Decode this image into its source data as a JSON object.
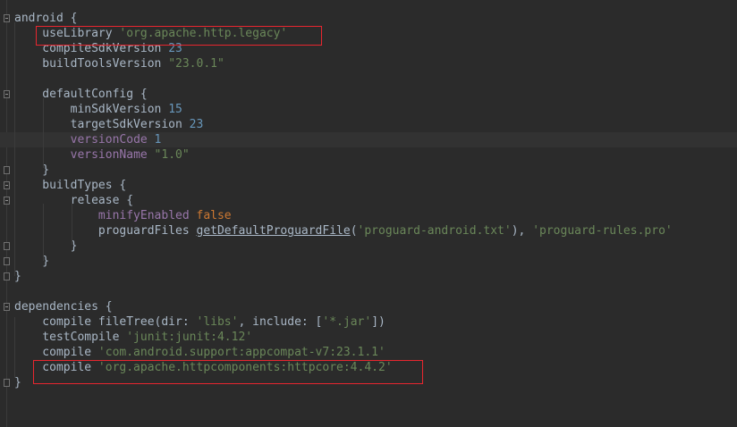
{
  "editor": {
    "lines": [
      {
        "tokens": [
          {
            "t": "android {",
            "c": "kw"
          }
        ]
      },
      {
        "tokens": [
          {
            "t": "    useLibrary ",
            "c": "kw"
          },
          {
            "t": "'org.apache.http.legacy'",
            "c": "str"
          }
        ]
      },
      {
        "tokens": [
          {
            "t": "    compileSdkVersion ",
            "c": "kw"
          },
          {
            "t": "23",
            "c": "num"
          }
        ]
      },
      {
        "tokens": [
          {
            "t": "    buildToolsVersion ",
            "c": "kw"
          },
          {
            "t": "\"23.0.1\"",
            "c": "str"
          }
        ]
      },
      {
        "tokens": [
          {
            "t": "",
            "c": "kw"
          }
        ]
      },
      {
        "tokens": [
          {
            "t": "    defaultConfig {",
            "c": "kw"
          }
        ]
      },
      {
        "tokens": [
          {
            "t": "        minSdkVersion ",
            "c": "kw"
          },
          {
            "t": "15",
            "c": "num"
          }
        ]
      },
      {
        "tokens": [
          {
            "t": "        targetSdkVersion ",
            "c": "kw"
          },
          {
            "t": "23",
            "c": "num"
          }
        ]
      },
      {
        "tokens": [
          {
            "t": "        ",
            "c": "kw"
          },
          {
            "t": "versionCode ",
            "c": "prop"
          },
          {
            "t": "1",
            "c": "num"
          }
        ]
      },
      {
        "tokens": [
          {
            "t": "        ",
            "c": "kw"
          },
          {
            "t": "versionName ",
            "c": "prop"
          },
          {
            "t": "\"1.0\"",
            "c": "str"
          }
        ]
      },
      {
        "tokens": [
          {
            "t": "    }",
            "c": "kw"
          }
        ]
      },
      {
        "tokens": [
          {
            "t": "    buildTypes {",
            "c": "kw"
          }
        ]
      },
      {
        "tokens": [
          {
            "t": "        release {",
            "c": "kw"
          }
        ]
      },
      {
        "tokens": [
          {
            "t": "            ",
            "c": "kw"
          },
          {
            "t": "minifyEnabled ",
            "c": "prop"
          },
          {
            "t": "false",
            "c": "bool"
          }
        ]
      },
      {
        "tokens": [
          {
            "t": "            proguardFiles ",
            "c": "kw"
          },
          {
            "t": "getDefaultProguardFile",
            "c": "method"
          },
          {
            "t": "(",
            "c": "kw"
          },
          {
            "t": "'proguard-android.txt'",
            "c": "str"
          },
          {
            "t": "), ",
            "c": "kw"
          },
          {
            "t": "'proguard-rules.pro'",
            "c": "str"
          }
        ]
      },
      {
        "tokens": [
          {
            "t": "        }",
            "c": "kw"
          }
        ]
      },
      {
        "tokens": [
          {
            "t": "    }",
            "c": "kw"
          }
        ]
      },
      {
        "tokens": [
          {
            "t": "}",
            "c": "kw"
          }
        ]
      },
      {
        "tokens": [
          {
            "t": "",
            "c": "kw"
          }
        ]
      },
      {
        "tokens": [
          {
            "t": "dependencies {",
            "c": "kw"
          }
        ]
      },
      {
        "tokens": [
          {
            "t": "    compile fileTree(dir: ",
            "c": "kw"
          },
          {
            "t": "'libs'",
            "c": "str"
          },
          {
            "t": ", include: [",
            "c": "kw"
          },
          {
            "t": "'*.jar'",
            "c": "str"
          },
          {
            "t": "])",
            "c": "kw"
          }
        ]
      },
      {
        "tokens": [
          {
            "t": "    testCompile ",
            "c": "kw"
          },
          {
            "t": "'junit:junit:4.12'",
            "c": "str"
          }
        ]
      },
      {
        "tokens": [
          {
            "t": "    compile ",
            "c": "kw"
          },
          {
            "t": "'com.android.support:appcompat-v7:23.1.1'",
            "c": "str"
          }
        ]
      },
      {
        "tokens": [
          {
            "t": "    compile ",
            "c": "kw"
          },
          {
            "t": "'org.apache.httpcomponents:httpcore:4.4.2'",
            "c": "str"
          }
        ]
      },
      {
        "tokens": [
          {
            "t": "}",
            "c": "kw"
          }
        ]
      }
    ]
  },
  "colors": {
    "background": "#2b2b2b",
    "text": "#a9b7c6",
    "string": "#6a8759",
    "number": "#6897bb",
    "property": "#9876aa",
    "keyword": "#cc7832",
    "highlight_box": "#e8262f"
  }
}
